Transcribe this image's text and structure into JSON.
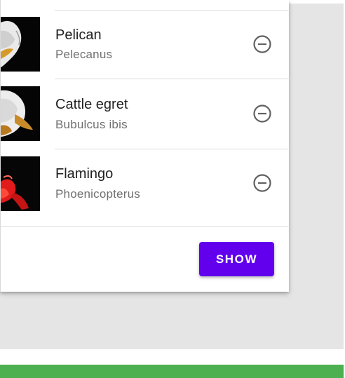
{
  "birds": [
    {
      "name": "Pelican",
      "scientific_name": "Pelecanus",
      "remove_icon": "remove-circle-outline-icon"
    },
    {
      "name": "Cattle egret",
      "scientific_name": "Bubulcus ibis",
      "remove_icon": "remove-circle-outline-icon"
    },
    {
      "name": "Flamingo",
      "scientific_name": "Phoenicopterus",
      "remove_icon": "remove-circle-outline-icon"
    }
  ],
  "actions": {
    "show_label": "SHOW"
  },
  "colors": {
    "primary": "#6200ee",
    "bottom_bar": "#4caf50",
    "scrim": "#e5e5e5"
  }
}
